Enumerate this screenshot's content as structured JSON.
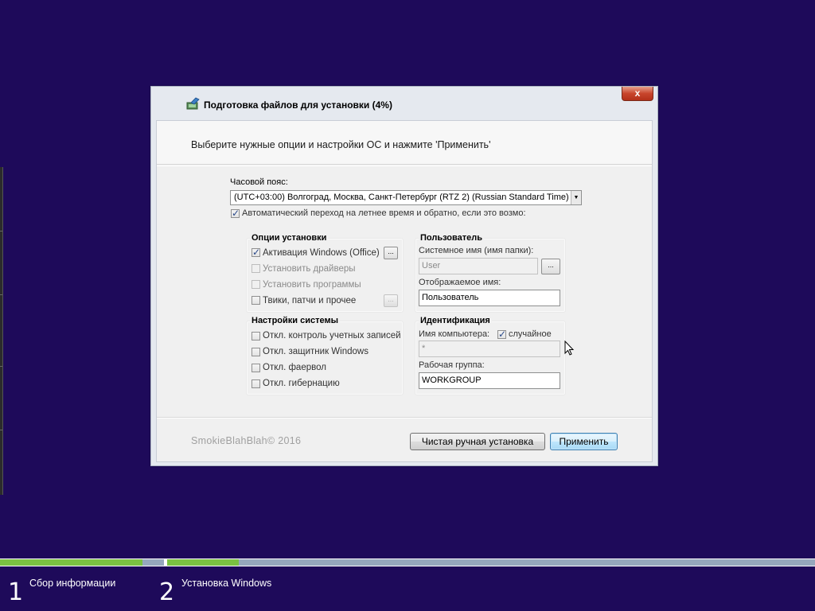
{
  "window": {
    "title": "Подготовка файлов для установки (4%)",
    "close_label": "x",
    "instruction": "Выберите нужные опции и настройки ОС и нажмите 'Применить'"
  },
  "timezone": {
    "label": "Часовой пояс:",
    "value": "(UTC+03:00) Волгоград, Москва, Санкт-Петербург (RTZ 2) (Russian Standard Time)",
    "dst_label": "Автоматический переход на летнее время и обратно, если это возмо:",
    "dst_checked": true
  },
  "install_options": {
    "title": "Опции установки",
    "items": [
      {
        "label": "Активация Windows (Office)",
        "checked": true,
        "enabled": true
      },
      {
        "label": "Установить драйверы",
        "checked": false,
        "enabled": false
      },
      {
        "label": "Установить программы",
        "checked": false,
        "enabled": false
      },
      {
        "label": "Твики, патчи и прочее",
        "checked": false,
        "enabled": true
      }
    ],
    "dots_label": "..."
  },
  "system_settings": {
    "title": "Настройки системы",
    "items": [
      {
        "label": "Откл. контроль учетных записей",
        "checked": false
      },
      {
        "label": "Откл. защитник Windows",
        "checked": false
      },
      {
        "label": "Откл. фаервол",
        "checked": false
      },
      {
        "label": "Откл. гибернацию",
        "checked": false
      }
    ]
  },
  "user": {
    "title": "Пользователь",
    "system_name_label": "Системное имя (имя папки):",
    "system_name_value": "User",
    "display_name_label": "Отображаемое имя:",
    "display_name_value": "Пользователь",
    "dots_label": "..."
  },
  "identification": {
    "title": "Идентификация",
    "computer_name_label": "Имя компьютера:",
    "random_label": "случайное",
    "random_checked": true,
    "computer_name_value": "*",
    "workgroup_label": "Рабочая группа:",
    "workgroup_value": "WORKGROUP"
  },
  "footer": {
    "copyright": "SmokieBlahBlah© 2016",
    "clean_install_button": "Чистая ручная установка",
    "apply_button": "Применить"
  },
  "setup_progress": {
    "step1_fill": 0.87,
    "step2_fill": 0.11,
    "steps": [
      {
        "number": "1",
        "label": "Сбор информации"
      },
      {
        "number": "2",
        "label": "Установка Windows"
      }
    ]
  },
  "colors": {
    "desktop_bg": "#1e0a5a",
    "progress_fill": "#7ac142",
    "progress_track": "#96a8bd"
  }
}
